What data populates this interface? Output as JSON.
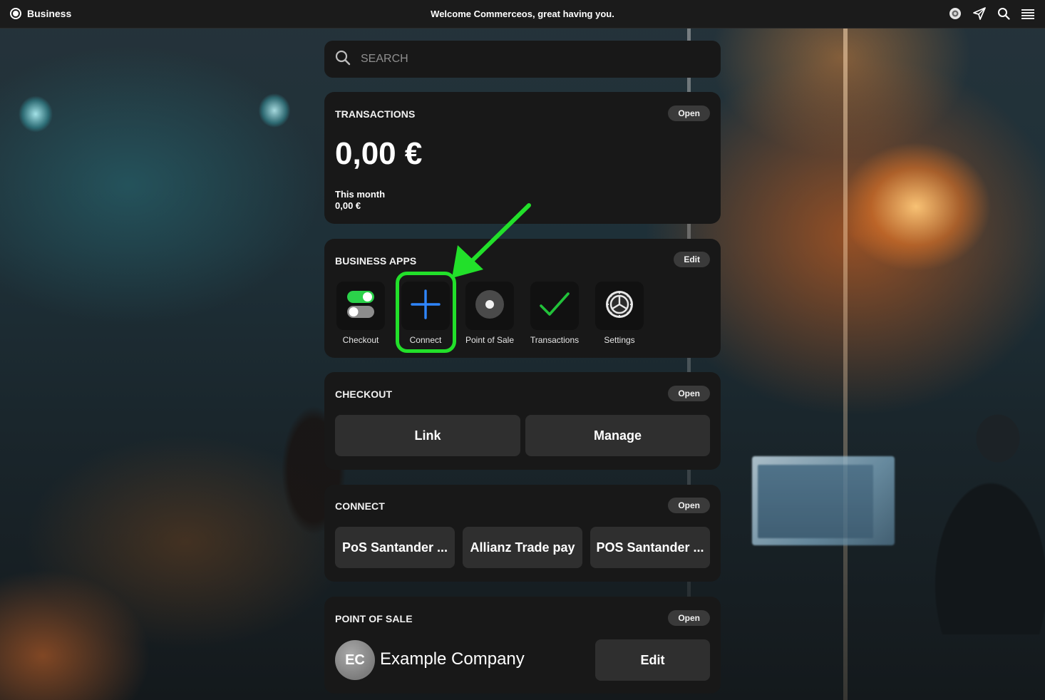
{
  "topbar": {
    "brand": "Business",
    "welcome": "Welcome Commerceos, great having you.",
    "icons": [
      "profile-icon",
      "send-icon",
      "search-icon",
      "menu-icon"
    ]
  },
  "search": {
    "placeholder": "SEARCH"
  },
  "transactions": {
    "title": "TRANSACTIONS",
    "action": "Open",
    "amount": "0,00 €",
    "month_label": "This month",
    "month_value": "0,00 €"
  },
  "business_apps": {
    "title": "BUSINESS APPS",
    "action": "Edit",
    "apps": [
      {
        "label": "Checkout",
        "icon": "toggle-icon"
      },
      {
        "label": "Connect",
        "icon": "plus-icon"
      },
      {
        "label": "Point of Sale",
        "icon": "pos-dot-icon"
      },
      {
        "label": "Transactions",
        "icon": "check-icon"
      },
      {
        "label": "Settings",
        "icon": "gear-icon"
      }
    ]
  },
  "checkout": {
    "title": "CHECKOUT",
    "action": "Open",
    "buttons": [
      "Link",
      "Manage"
    ]
  },
  "connect": {
    "title": "CONNECT",
    "action": "Open",
    "buttons": [
      "PoS Santander ...",
      "Allianz Trade pay",
      "POS Santander ..."
    ]
  },
  "point_of_sale": {
    "title": "POINT OF SALE",
    "action": "Open",
    "avatar": "EC",
    "company": "Example Company",
    "edit": "Edit"
  },
  "colors": {
    "highlight": "#22e02a",
    "connect_plus": "#2f86ff",
    "check": "#22c23a"
  }
}
